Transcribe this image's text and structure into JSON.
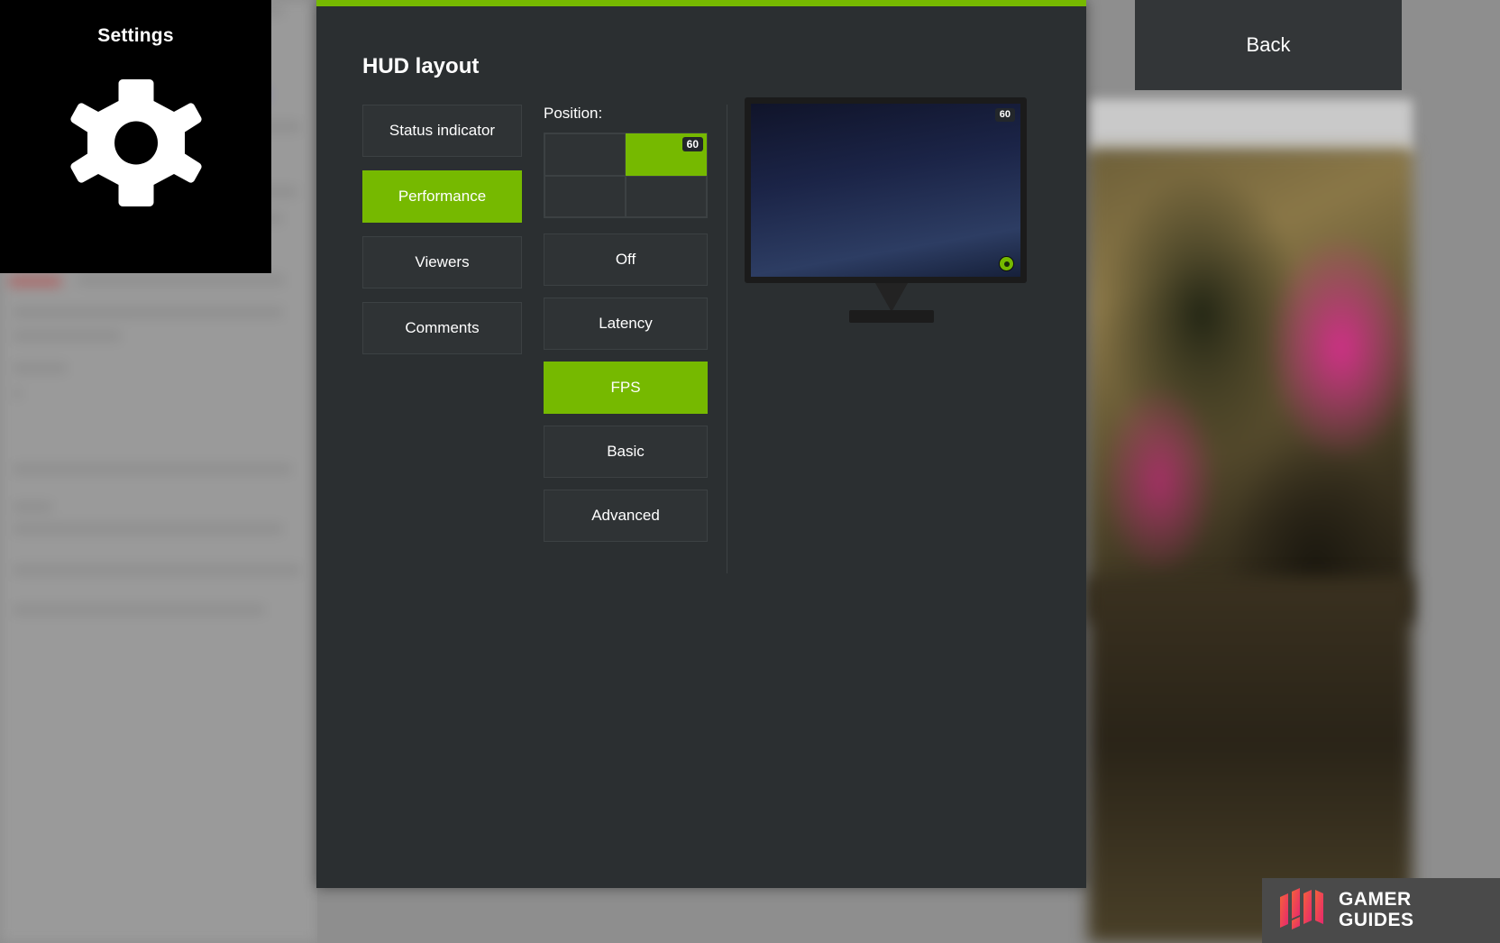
{
  "settings_panel": {
    "title": "Settings",
    "icon": "gear-icon"
  },
  "back_button": {
    "label": "Back"
  },
  "dialog": {
    "title": "HUD layout",
    "accent_color": "#76b900",
    "background_color": "#2b2f31",
    "categories": [
      {
        "label": "Status indicator",
        "active": false
      },
      {
        "label": "Performance",
        "active": true
      },
      {
        "label": "Viewers",
        "active": false
      },
      {
        "label": "Comments",
        "active": false
      }
    ],
    "position": {
      "label": "Position:",
      "cells": [
        {
          "name": "top-left",
          "selected": false,
          "badge": ""
        },
        {
          "name": "top-right",
          "selected": true,
          "badge": "60"
        },
        {
          "name": "bottom-left",
          "selected": false,
          "badge": ""
        },
        {
          "name": "bottom-right",
          "selected": false,
          "badge": ""
        }
      ]
    },
    "options": [
      {
        "label": "Off",
        "active": false
      },
      {
        "label": "Latency",
        "active": false
      },
      {
        "label": "FPS",
        "active": true
      },
      {
        "label": "Basic",
        "active": false
      },
      {
        "label": "Advanced",
        "active": false
      }
    ],
    "preview": {
      "fps_badge": "60",
      "nvidia_indicator": "nvidia-status-icon"
    }
  },
  "watermark": {
    "line1": "GAMER",
    "line2": "GUIDES"
  }
}
